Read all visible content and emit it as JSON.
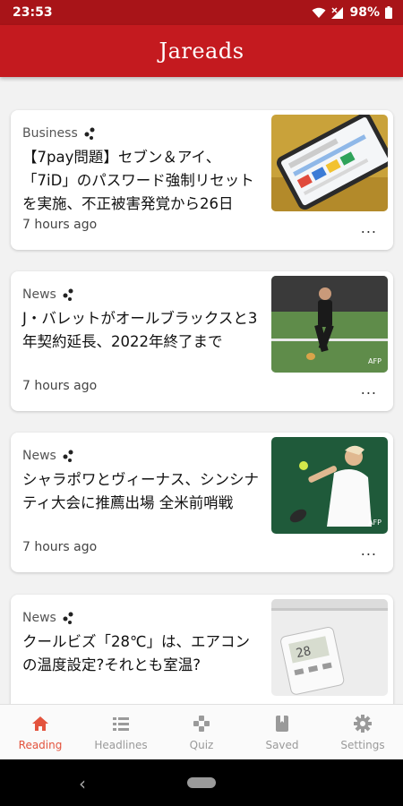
{
  "status_bar": {
    "time": "23:53",
    "battery": "98%"
  },
  "app": {
    "title": "Jareads"
  },
  "articles": [
    {
      "category": "Business",
      "title": "【7pay問題】セブン＆アイ、「7iD」のパスワード強制リセットを実施、不正被害発覚から26日",
      "time": "7 hours ago",
      "more": "..."
    },
    {
      "category": "News",
      "title": "J・バレットがオールブラックスと3年契約延長、2022年終了まで",
      "time": "7 hours ago",
      "more": "..."
    },
    {
      "category": "News",
      "title": "シャラポワとヴィーナス、シンシナティ大会に推薦出場 全米前哨戦",
      "time": "7 hours ago",
      "more": "..."
    },
    {
      "category": "News",
      "title": "クールビズ「28℃」は、エアコンの温度設定?それとも室温?",
      "time": "",
      "more": ""
    }
  ],
  "bottom_nav": [
    {
      "label": "Reading",
      "icon": "home-icon",
      "active": true
    },
    {
      "label": "Headlines",
      "icon": "list-icon",
      "active": false
    },
    {
      "label": "Quiz",
      "icon": "gamepad-icon",
      "active": false
    },
    {
      "label": "Saved",
      "icon": "bookmark-icon",
      "active": false
    },
    {
      "label": "Settings",
      "icon": "gear-icon",
      "active": false
    }
  ],
  "colors": {
    "status_bar": "#a81418",
    "app_bar": "#c41a1f",
    "accent": "#e3533d"
  }
}
